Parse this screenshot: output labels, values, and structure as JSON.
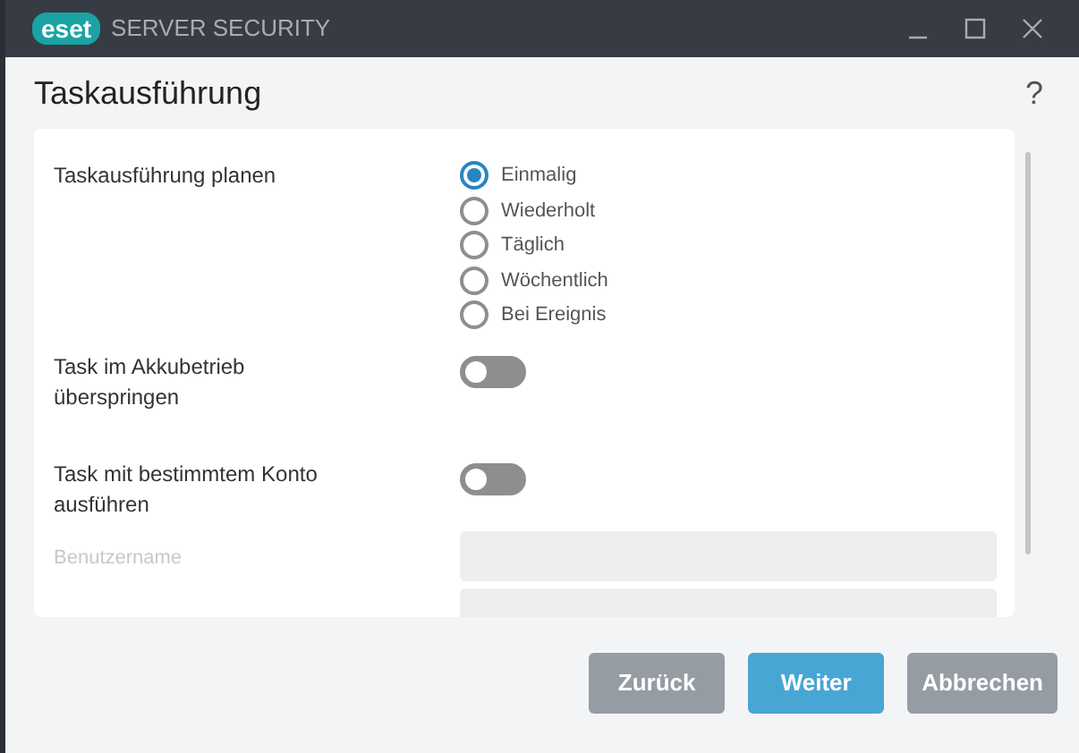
{
  "window": {
    "logo": "eset",
    "title": "SERVER SECURITY"
  },
  "page": {
    "title": "Taskausführung",
    "help": "?"
  },
  "schedule": {
    "label": "Taskausführung planen",
    "options": [
      {
        "label": "Einmalig",
        "selected": true
      },
      {
        "label": "Wiederholt",
        "selected": false
      },
      {
        "label": "Täglich",
        "selected": false
      },
      {
        "label": "Wöchentlich",
        "selected": false
      },
      {
        "label": "Bei Ereignis",
        "selected": false
      }
    ]
  },
  "toggles": [
    {
      "label": "Task im Akkubetrieb überspringen",
      "on": false
    },
    {
      "label": "Task mit bestimmtem Konto ausführen",
      "on": false
    }
  ],
  "fields": [
    {
      "label": "Benutzername",
      "disabled": true
    },
    {
      "disabled": true
    }
  ],
  "buttons": [
    {
      "label": "Zurück",
      "kind": "secondary"
    },
    {
      "label": "Weiter",
      "kind": "primary"
    },
    {
      "label": "Abbrechen",
      "kind": "secondary"
    }
  ]
}
